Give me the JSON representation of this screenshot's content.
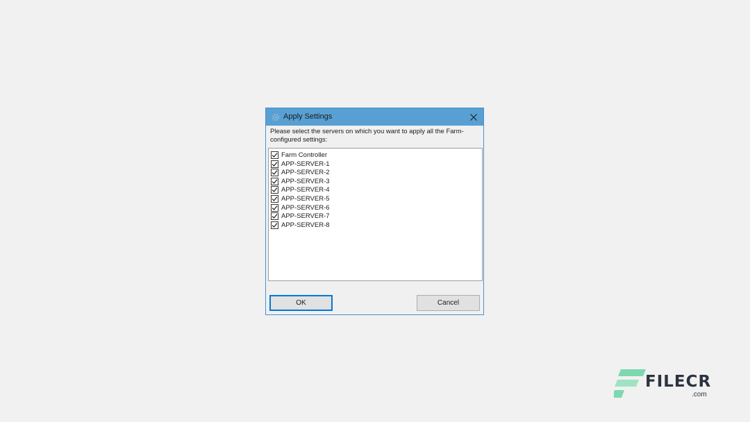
{
  "dialog": {
    "title": "Apply Settings",
    "icon": "gear-icon",
    "prompt": "Please select the servers on which you want to apply all the Farm-configured settings:",
    "servers": [
      {
        "label": "Farm Controller",
        "checked": true
      },
      {
        "label": "APP-SERVER-1",
        "checked": true
      },
      {
        "label": "APP-SERVER-2",
        "checked": true
      },
      {
        "label": "APP-SERVER-3",
        "checked": true
      },
      {
        "label": "APP-SERVER-4",
        "checked": true
      },
      {
        "label": "APP-SERVER-5",
        "checked": true
      },
      {
        "label": "APP-SERVER-6",
        "checked": true
      },
      {
        "label": "APP-SERVER-7",
        "checked": true
      },
      {
        "label": "APP-SERVER-8",
        "checked": true
      }
    ],
    "ok_label": "OK",
    "cancel_label": "Cancel"
  },
  "watermark": {
    "name": "FILECR",
    "domain": ".com"
  },
  "colors": {
    "titlebar": "#58a0d4",
    "focus_border": "#0078d7",
    "logo_mark": "#7dd8b0"
  }
}
